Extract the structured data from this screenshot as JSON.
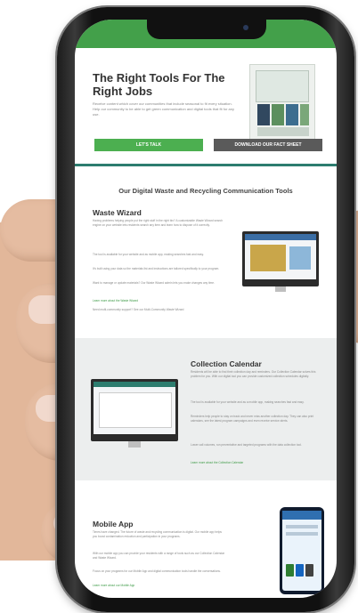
{
  "hero": {
    "title": "The Right Tools For The Right Jobs",
    "text": "Receive content which cover our communities that include seasonal to fit every situation. Help our community to be able to get green communication and digital tools that fit for any use."
  },
  "buttons": {
    "talk": "LET'S TALK",
    "fact_sheet": "DOWNLOAD OUR FACT SHEET"
  },
  "section_title": "Our Digital Waste and Recycling Communication Tools",
  "waste_wizard": {
    "title": "Waste Wizard",
    "p1": "Having problems helping people put the right stuff in the right bin? A customizable Waste Wizard search engine on your website lets residents search any item and learn how to dispose of it correctly.",
    "p2": "The tool is available for your website and as mobile app, making searches fast and easy.",
    "p3": "It's built using your data so the materials list and instructions are tailored specifically to your program.",
    "p4": "Want to manage or update materials? Our Waste Wizard admin lets you make changes any time.",
    "learn": "Learn more about the Waste Wizard",
    "more": "Need multi-community support? See our Multi-Community Waste Wizard"
  },
  "collection_calendar": {
    "title": "Collection Calendar",
    "p1": "Residents will be able to find their collection day and reminders. Our Collection Calendar solves this problem for you. With our digital tool you can provide customized collection schedules digitally.",
    "p2": "The tool is available for your website and as a mobile app, making searches fast and easy.",
    "p3": "Reminders help people to stay on track and never miss another collection day. They can also print calendars, see the latest program campaigns and even receive service alerts.",
    "p4": "Lower call volumes, run preventative and targeted programs with the data collection tool.",
    "learn": "Learn more about the Collection Calendar"
  },
  "mobile_app": {
    "title": "Mobile App",
    "p1": "Times have changed. The future of waste and recycling communication is digital. Our mobile app helps you boost contamination reduction and participation in your programs.",
    "p2": "With our mobile app you can provide your residents with a range of tools such as our Collection Calendar and Waste Wizard.",
    "p3": "Focus on your programs for our Mobile App and digital communication tools handle the conversations.",
    "learn": "Learn more about our Mobile App"
  },
  "colors": {
    "brand_green": "#43a04a",
    "button_green": "#4caf50",
    "button_grey": "#5a5a5a",
    "teal_divider": "#2d7d6f"
  }
}
